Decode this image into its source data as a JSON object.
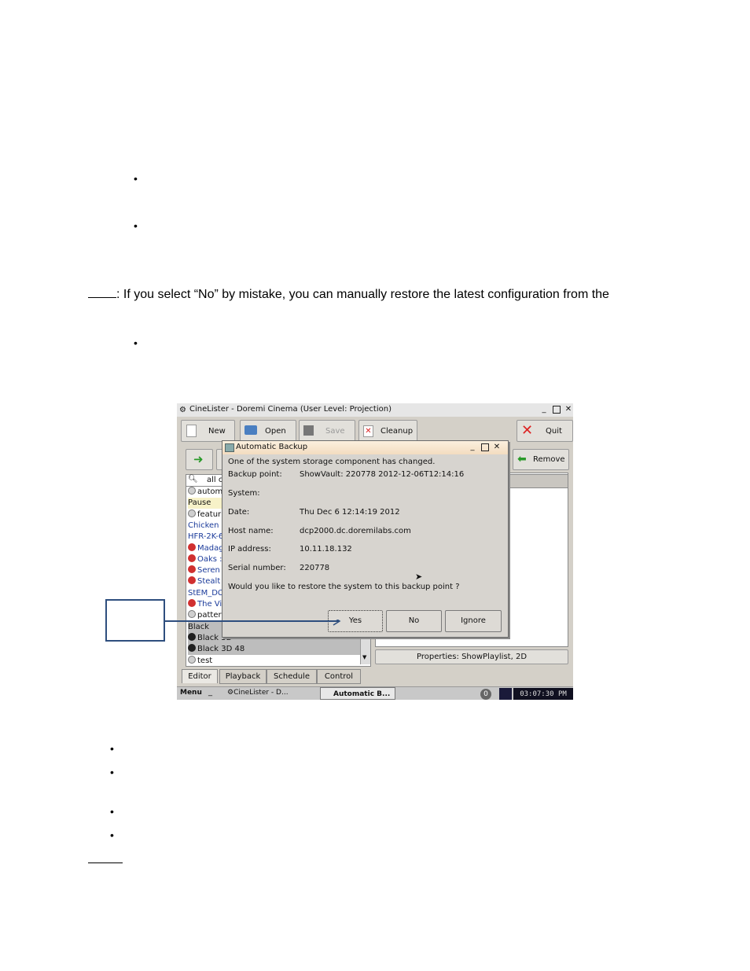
{
  "note": {
    "text": ": If you select “No” by mistake, you can manually restore the latest configuration from the"
  },
  "screenshot": {
    "window_title": "CineLister - Doremi Cinema (User Level: Projection)",
    "toolbar": {
      "new": "New",
      "open": "Open",
      "save": "Save",
      "cleanup": "Cleanup",
      "quit": "Quit",
      "remove": "Remove"
    },
    "search_text": "all c",
    "list_items": [
      {
        "label": "autom",
        "icon": "gear-icon"
      },
      {
        "label": "Pause",
        "icon": ""
      },
      {
        "label": "featur",
        "icon": "gear-icon"
      },
      {
        "label": "Chicken l",
        "icon": ""
      },
      {
        "label": "HFR-2K-6",
        "icon": ""
      },
      {
        "label": "Madag",
        "icon": "red-3d-icon"
      },
      {
        "label": "Oaks :",
        "icon": "red-3d-icon"
      },
      {
        "label": "Seren",
        "icon": "red-3d-icon"
      },
      {
        "label": "Stealt",
        "icon": "red-3d-icon"
      },
      {
        "label": "StEM_DC",
        "icon": ""
      },
      {
        "label": "The Vi",
        "icon": "red-3d-icon"
      },
      {
        "label": "patter",
        "icon": "gear-icon"
      },
      {
        "label": "Black",
        "icon": ""
      },
      {
        "label": "Black 3D",
        "icon": "3d-icon"
      },
      {
        "label": "Black 3D 48",
        "icon": "3d-icon"
      },
      {
        "label": "test",
        "icon": "gear-icon"
      }
    ],
    "properties_button": "Properties: ShowPlaylist, 2D",
    "tabs": [
      "Editor",
      "Playback",
      "Schedule",
      "Control"
    ],
    "taskbar": {
      "menu": "Menu",
      "task1": "CineLister - D...",
      "task2": "Automatic B...",
      "badge": "0",
      "clock": "03:07:30 PM"
    },
    "dialog": {
      "title": "Automatic Backup",
      "message": "One of the system storage component has changed.",
      "fields": [
        {
          "label": "Backup point:",
          "value": "ShowVault: 220778 2012-12-06T12:14:16"
        },
        {
          "label": "System:",
          "value": ""
        },
        {
          "label": "Date:",
          "value": "Thu Dec 6 12:14:19 2012"
        },
        {
          "label": "Host name:",
          "value": "dcp2000.dc.doremilabs.com"
        },
        {
          "label": "IP address:",
          "value": "10.11.18.132"
        },
        {
          "label": "Serial number:",
          "value": "220778"
        }
      ],
      "question": "Would you like to restore the system to this backup point ?",
      "buttons": {
        "yes": "Yes",
        "no": "No",
        "ignore": "Ignore"
      }
    }
  }
}
